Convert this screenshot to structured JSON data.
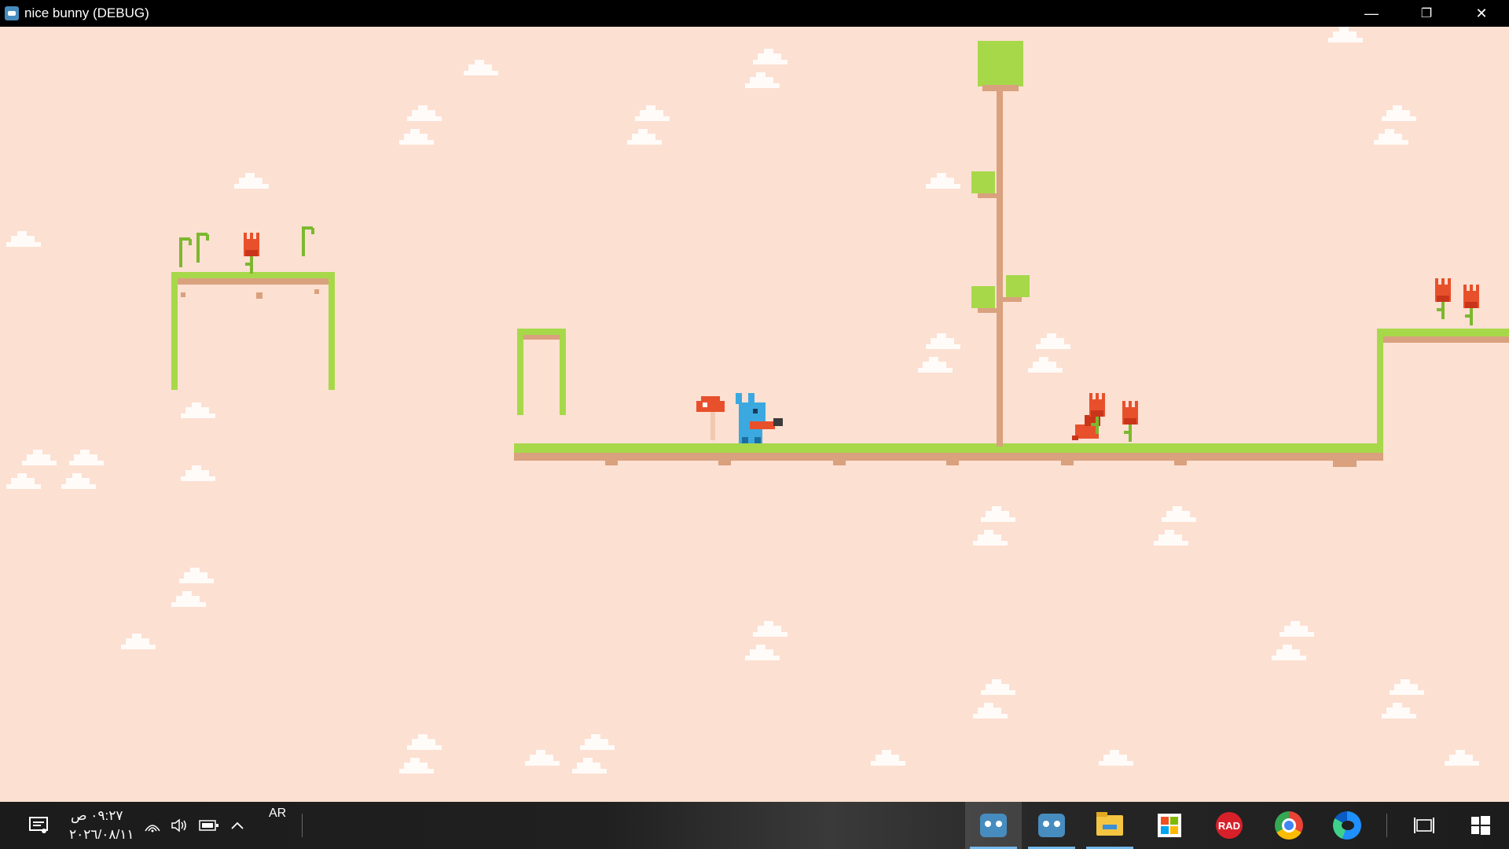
{
  "window": {
    "title": "nice bunny (DEBUG)",
    "controls": {
      "minimize": "—",
      "restore": "❐",
      "close": "✕"
    }
  },
  "game": {
    "background_color": "#fce0d2",
    "grass_color": "#a7d84a",
    "dirt_color": "#d9a17e",
    "flower_color": "#e8502c",
    "player_color": "#3ba9e0"
  },
  "taskbar": {
    "clock_time": "٠٩:٢٧ ص",
    "clock_date": "٢٠٢٦/٠٨/١١",
    "language": "AR",
    "rad_label": "RAD",
    "apps": [
      {
        "name": "godot-game"
      },
      {
        "name": "godot-editor"
      },
      {
        "name": "file-explorer"
      },
      {
        "name": "microsoft-store"
      },
      {
        "name": "rad-studio"
      },
      {
        "name": "chrome"
      },
      {
        "name": "edge"
      }
    ]
  }
}
